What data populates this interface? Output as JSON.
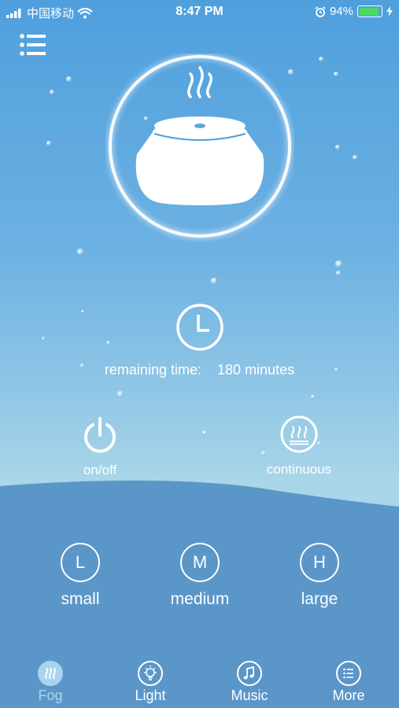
{
  "status_bar": {
    "carrier": "中国移动",
    "time": "8:47 PM",
    "battery_percent": "94%",
    "battery_level": 0.94,
    "battery_color": "#4cd964"
  },
  "header": {
    "menu_icon": "list-menu-icon"
  },
  "device": {
    "icon": "humidifier-icon"
  },
  "timer": {
    "icon": "clock-icon",
    "label": "remaining time:",
    "value": "180 minutes"
  },
  "controls": {
    "power_label": "on/off",
    "mode_label": "continuous"
  },
  "fog_levels": [
    {
      "letter": "L",
      "label": "small"
    },
    {
      "letter": "M",
      "label": "medium"
    },
    {
      "letter": "H",
      "label": "large"
    }
  ],
  "tabs": [
    {
      "label": "Fog",
      "icon": "fog-icon",
      "active": true
    },
    {
      "label": "Light",
      "icon": "light-bulb-icon",
      "active": false
    },
    {
      "label": "Music",
      "icon": "music-note-icon",
      "active": false
    },
    {
      "label": "More",
      "icon": "more-list-icon",
      "active": false
    }
  ],
  "colors": {
    "background_top": "#4f9fdd",
    "background_bottom": "#a9d6e8",
    "panel": "#5b96c9",
    "active_tab": "#a7d3ef"
  }
}
